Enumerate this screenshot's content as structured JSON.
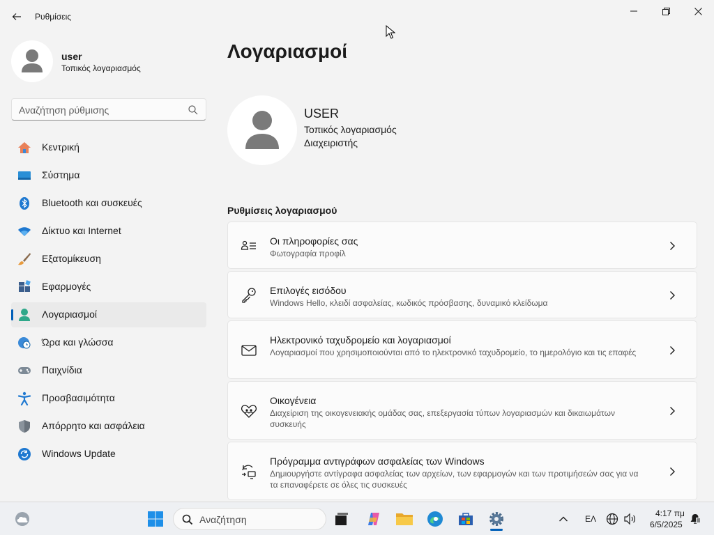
{
  "window": {
    "title": "Ρυθμίσεις"
  },
  "profile": {
    "name": "user",
    "account_type": "Τοπικός λογαριασμός"
  },
  "search": {
    "placeholder": "Αναζήτηση ρύθμισης"
  },
  "nav": {
    "items": [
      {
        "label": "Κεντρική",
        "icon": "home-icon"
      },
      {
        "label": "Σύστημα",
        "icon": "monitor-icon"
      },
      {
        "label": "Bluetooth και συσκευές",
        "icon": "bluetooth-icon"
      },
      {
        "label": "Δίκτυο και Internet",
        "icon": "wifi-icon"
      },
      {
        "label": "Εξατομίκευση",
        "icon": "brush-icon"
      },
      {
        "label": "Εφαρμογές",
        "icon": "apps-icon"
      },
      {
        "label": "Λογαριασμοί",
        "icon": "person-icon",
        "active": true
      },
      {
        "label": "Ώρα και γλώσσα",
        "icon": "globe-clock-icon"
      },
      {
        "label": "Παιχνίδια",
        "icon": "gamepad-icon"
      },
      {
        "label": "Προσβασιμότητα",
        "icon": "accessibility-icon"
      },
      {
        "label": "Απόρρητο και ασφάλεια",
        "icon": "shield-icon"
      },
      {
        "label": "Windows Update",
        "icon": "update-icon"
      }
    ]
  },
  "main": {
    "title": "Λογαριασμοί",
    "user": {
      "name": "USER",
      "account_type": "Τοπικός λογαριασμός",
      "role": "Διαχειριστής"
    },
    "section_title": "Ρυθμίσεις λογαριασμού",
    "cards": [
      {
        "title": "Οι πληροφορίες σας",
        "subtitle": "Φωτογραφία προφίλ",
        "icon": "user-info-icon"
      },
      {
        "title": "Επιλογές εισόδου",
        "subtitle": "Windows Hello, κλειδί ασφαλείας, κωδικός πρόσβασης, δυναμικό κλείδωμα",
        "icon": "key-icon"
      },
      {
        "title": "Ηλεκτρονικό ταχυδρομείο και λογαριασμοί",
        "subtitle": "Λογαριασμοί που χρησιμοποιούνται από το ηλεκτρονικό ταχυδρομείο, το ημερολόγιο και τις επαφές",
        "icon": "mail-icon"
      },
      {
        "title": "Οικογένεια",
        "subtitle": "Διαχείριση της οικογενειακής ομάδας σας, επεξεργασία τύπων λογαριασμών και δικαιωμάτων συσκευής",
        "icon": "family-heart-icon"
      },
      {
        "title": "Πρόγραμμα αντιγράφων ασφαλείας των Windows",
        "subtitle": "Δημιουργήστε αντίγραφα ασφαλείας των αρχείων, των εφαρμογών και των προτιμήσεών σας για να τα επαναφέρετε σε όλες τις συσκευές",
        "icon": "backup-icon"
      }
    ]
  },
  "taskbar": {
    "search_label": "Αναζήτηση",
    "language": "ΕΛ",
    "time": "4:17 πμ",
    "date": "6/5/2025"
  },
  "colors": {
    "accent": "#005fb8",
    "background": "#f3f3f3",
    "card": "#fbfbfb"
  }
}
